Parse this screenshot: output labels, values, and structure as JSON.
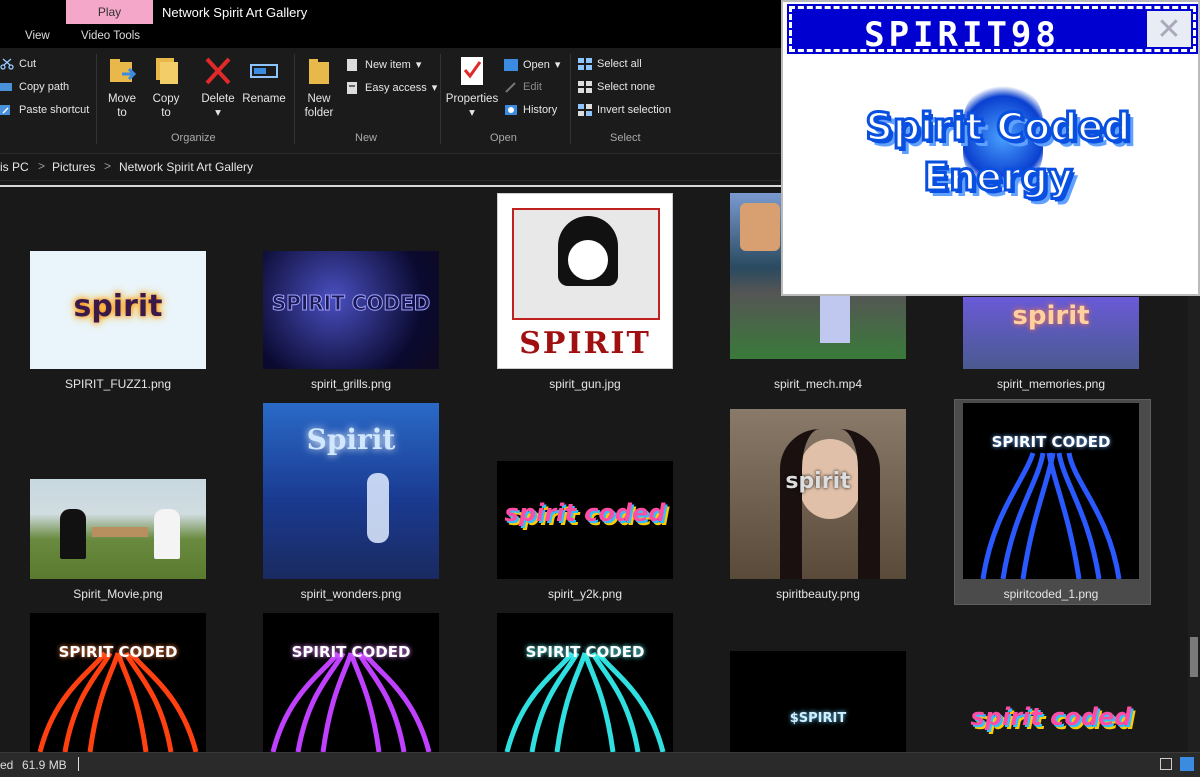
{
  "window": {
    "play_tab": "Play",
    "title": "Network Spirit Art Gallery"
  },
  "tabs": [
    "View",
    "Video Tools"
  ],
  "ribbon": {
    "clipboard": {
      "cut": "Cut",
      "copy_path": "Copy path",
      "paste_shortcut": "Paste shortcut"
    },
    "organize": {
      "move_to": "Move",
      "move_to2": "to",
      "copy_to": "Copy",
      "copy_to2": "to",
      "delete": "Delete",
      "rename": "Rename",
      "label": "Organize"
    },
    "new": {
      "new_folder": "New",
      "new_folder2": "folder",
      "new_item": "New item",
      "easy_access": "Easy access",
      "label": "New"
    },
    "open": {
      "properties": "Properties",
      "open": "Open",
      "edit": "Edit",
      "history": "History",
      "label": "Open"
    },
    "select": {
      "select_all": "Select all",
      "select_none": "Select none",
      "invert": "Invert selection",
      "label": "Select"
    }
  },
  "breadcrumb": {
    "this_pc": "is PC",
    "pictures": "Pictures",
    "folder": "Network Spirit Art Gallery",
    "sep": ">"
  },
  "files": [
    {
      "name": "SPIRIT_FUZZ1.png",
      "text": "spirit"
    },
    {
      "name": "spirit_grills.png",
      "text": "SPIRIT CODED"
    },
    {
      "name": "spirit_gun.jpg",
      "text": "SPIRIT"
    },
    {
      "name": "spirit_mech.mp4",
      "text": ""
    },
    {
      "name": "spirit_memories.png",
      "text": "spirit"
    },
    {
      "name": "Spirit_Movie.png",
      "text": ""
    },
    {
      "name": "spirit_wonders.png",
      "text": "Spirit"
    },
    {
      "name": "spirit_y2k.png",
      "text": "spirit coded"
    },
    {
      "name": "spiritbeauty.png",
      "text": "spirit"
    },
    {
      "name": "spiritcoded_1.png",
      "text": "SPIRIT CODED"
    },
    {
      "name": "",
      "text": "SPIRIT CODED"
    },
    {
      "name": "",
      "text": "SPIRIT CODED"
    },
    {
      "name": "",
      "text": "SPIRIT CODED"
    },
    {
      "name": "",
      "text": "$SPIRIT"
    },
    {
      "name": "",
      "text": "spirit coded"
    }
  ],
  "status": {
    "selected": "ed",
    "size": "61.9 MB"
  },
  "popup": {
    "title": "SPIRIT98",
    "close": "✕",
    "art_text": "Spirit Coded Energy"
  },
  "colors": {
    "accent_blue": "#0000d0",
    "play_pink": "#f4a7c8",
    "selection": "#4b4b4b"
  }
}
